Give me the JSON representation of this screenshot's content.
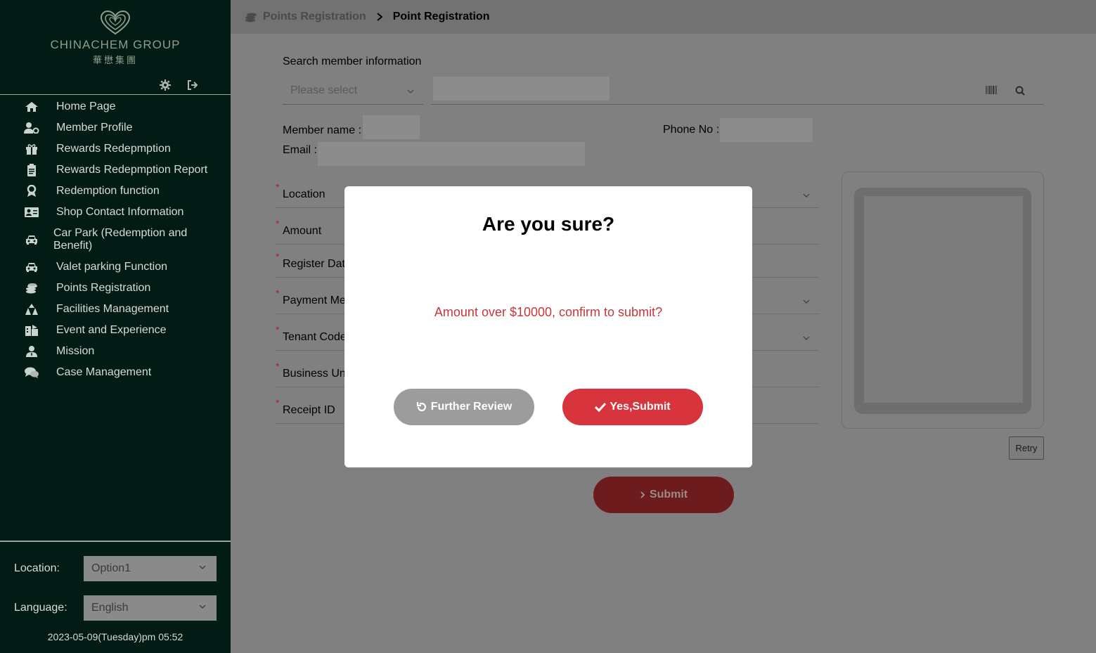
{
  "brand": {
    "name_en": "CHINACHEM GROUP",
    "name_cn": "華懋集團"
  },
  "sidebar": {
    "items": [
      {
        "label": "Home Page",
        "icon": "home-icon"
      },
      {
        "label": "Member Profile",
        "icon": "user-cog-icon"
      },
      {
        "label": "Rewards Redepmption",
        "icon": "gift-icon"
      },
      {
        "label": "Rewards Redepmption Report",
        "icon": "clipboard-icon"
      },
      {
        "label": "Redemption function",
        "icon": "award-icon"
      },
      {
        "label": "Shop Contact Information",
        "icon": "id-card-icon"
      },
      {
        "label": "Car Park (Redemption and Benefit)",
        "icon": "car-icon"
      },
      {
        "label": "Valet parking Function",
        "icon": "car-icon"
      },
      {
        "label": "Points Registration",
        "icon": "coins-icon"
      },
      {
        "label": "Facilities Management",
        "icon": "sitemap-icon"
      },
      {
        "label": "Event and Experience",
        "icon": "event-icon"
      },
      {
        "label": "Mission",
        "icon": "user-tie-icon"
      },
      {
        "label": "Case Management",
        "icon": "comments-icon"
      }
    ],
    "location_label": "Location:",
    "location_value": "Option1",
    "language_label": "Language:",
    "language_value": "English",
    "datetime": "2023-05-09(Tuesday)pm 05:52"
  },
  "breadcrumb": {
    "parent": "Points Registration",
    "current": "Point Registration"
  },
  "search": {
    "label": "Search member information",
    "select_placeholder": "Please select"
  },
  "member": {
    "name_label": "Member name :",
    "phone_label": "Phone No :",
    "email_label": "Email :"
  },
  "form": {
    "fields": [
      {
        "label": "Location"
      },
      {
        "label": "Amount"
      },
      {
        "label": "Register Dat"
      },
      {
        "label": "Payment Me"
      },
      {
        "label": "Tenant Code"
      },
      {
        "label": "Business Un"
      },
      {
        "label": "Receipt ID"
      }
    ],
    "required_mark": "*"
  },
  "retry_label": "Retry",
  "submit_label": "Submit",
  "modal": {
    "title": "Are you sure?",
    "message": "Amount over $10000, confirm to submit?",
    "review_label": "Further Review",
    "confirm_label": "Yes,Submit"
  },
  "colors": {
    "sidebar_bg": "#021b15",
    "accent_red": "#d8343d",
    "message_red": "#c8353a",
    "overlay": "#808080"
  }
}
